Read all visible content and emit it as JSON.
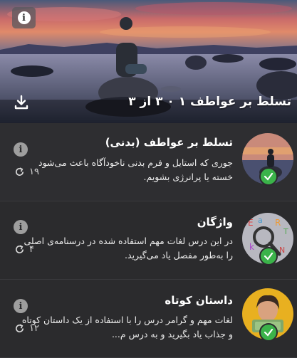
{
  "header": {
    "title": "تسلط بر عواطف ۱ ۰ ۳ از ۳",
    "info_icon": "info-icon",
    "download_icon": "download-icon"
  },
  "lessons": [
    {
      "title": "تسلط بر عواطف (بدنی)",
      "description": "جوری که استایل و فرم بدنی ناخودآگاه باعث می‌شود خسته یا پرانرژی بشویم.",
      "count": "۱۹",
      "status": "completed"
    },
    {
      "title": "واژگان",
      "description": "در این درس لغات مهم استفاده شده در درسنامه‌ی اصلی را به‌طور مفصل یاد می‌گیرید.",
      "count": "۴",
      "status": "completed"
    },
    {
      "title": "داستان کوتاه",
      "description": "لغات مهم و گرامر درس را با استفاده از یک داستان کوتاه و جذاب یاد بگیرید و به درس م...",
      "count": "۱۲",
      "status": "completed"
    }
  ],
  "colors": {
    "check": "#3bb34a",
    "background": "#2b2b2d"
  }
}
